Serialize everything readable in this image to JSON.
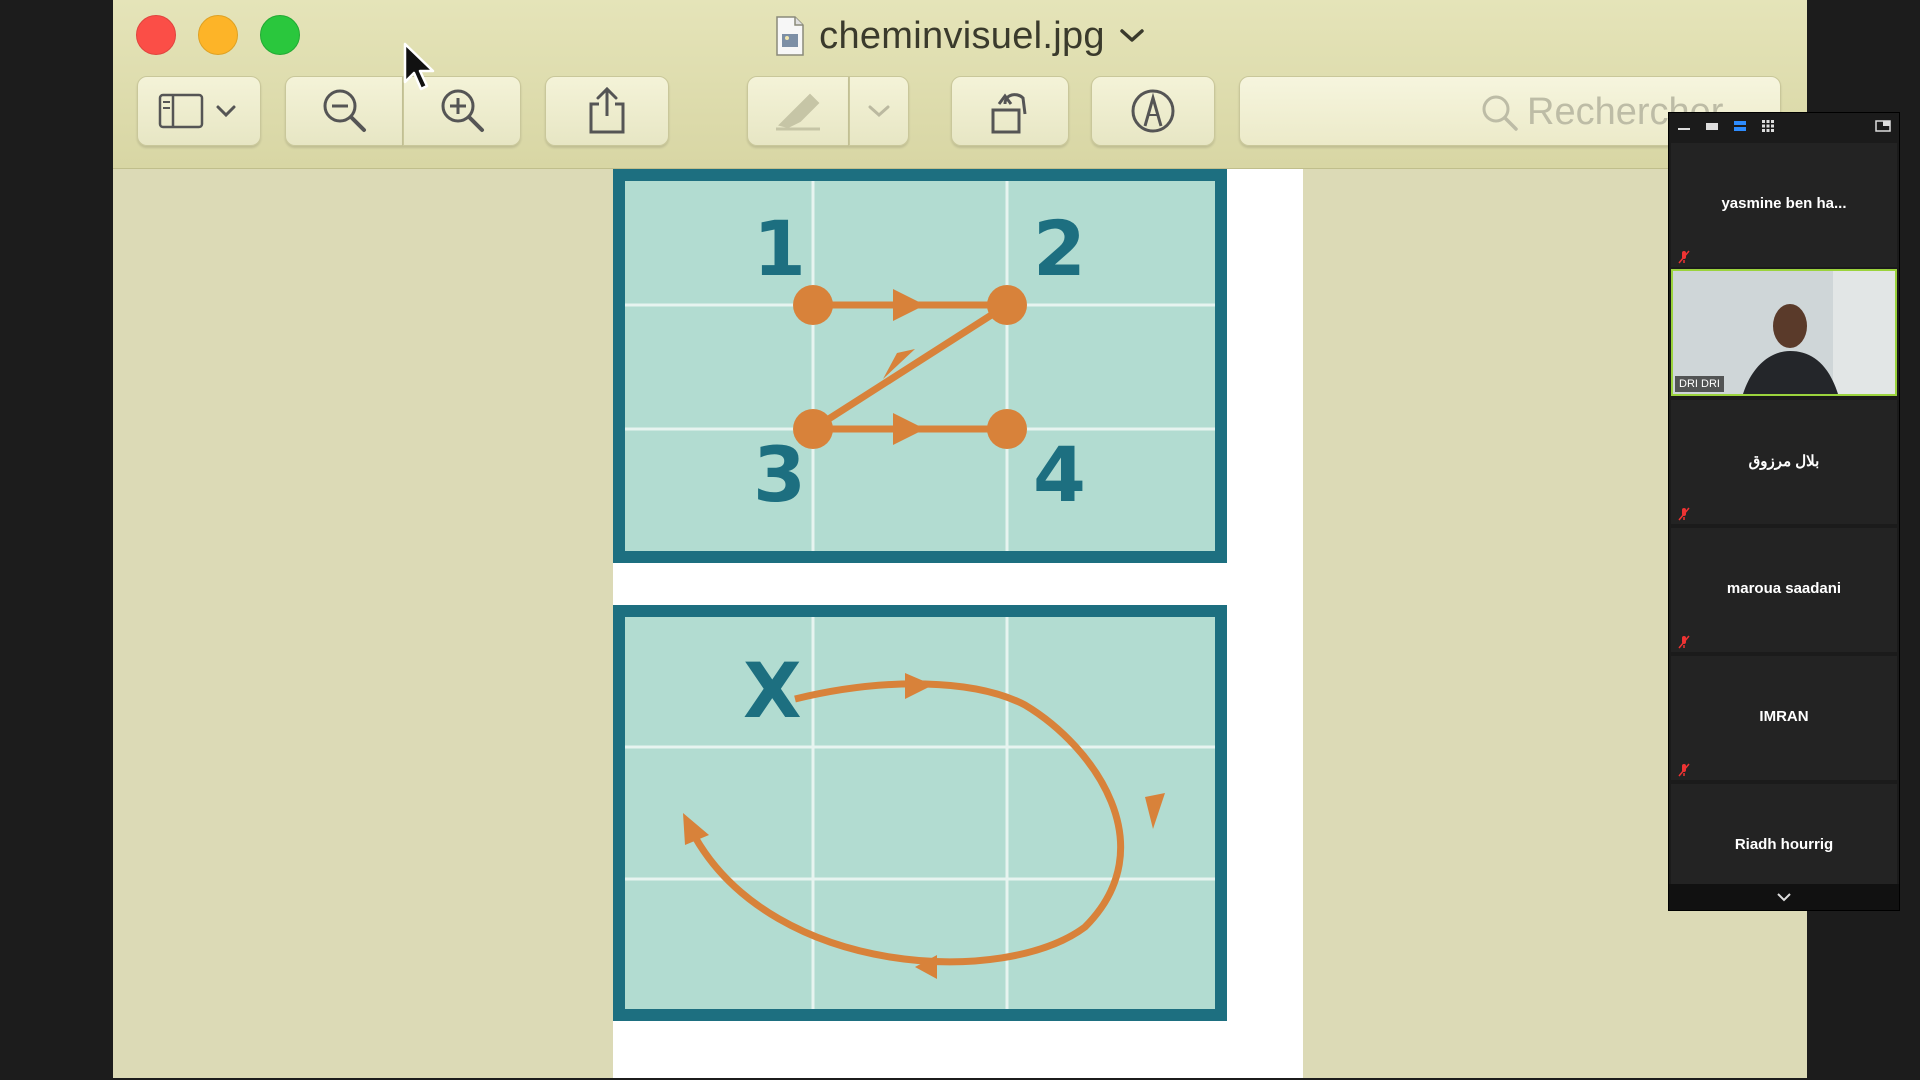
{
  "window": {
    "title": "cheminvisuel.jpg",
    "file_icon": "image-file-icon",
    "traffic_lights": {
      "close": "#fb4e47",
      "minimize": "#fdb428",
      "maximize": "#2ac73d"
    }
  },
  "toolbar": {
    "buttons": [
      "sidebar-toggle",
      "zoom-out",
      "zoom-in",
      "share",
      "highlight",
      "highlight-menu",
      "rotate",
      "markup"
    ],
    "search_placeholder": "Rechercher"
  },
  "document": {
    "figure_z": {
      "labels": [
        "1",
        "2",
        "3",
        "4"
      ]
    },
    "figure_circle": {
      "label": "X"
    },
    "colors": {
      "grid_fill": "#b2dcd1",
      "border": "#1d6f80",
      "arrow": "#d8823a"
    }
  },
  "zoom_panel": {
    "participants": [
      {
        "name": "yasmine ben ha...",
        "muted": true
      },
      {
        "name": "DRI DRI",
        "video": true
      },
      {
        "name": "بلال مرزوق",
        "muted": true
      },
      {
        "name": "maroua saadani",
        "muted": true
      },
      {
        "name": "IMRAN",
        "muted": true
      },
      {
        "name": "Riadh hourrig",
        "muted": false
      }
    ]
  }
}
